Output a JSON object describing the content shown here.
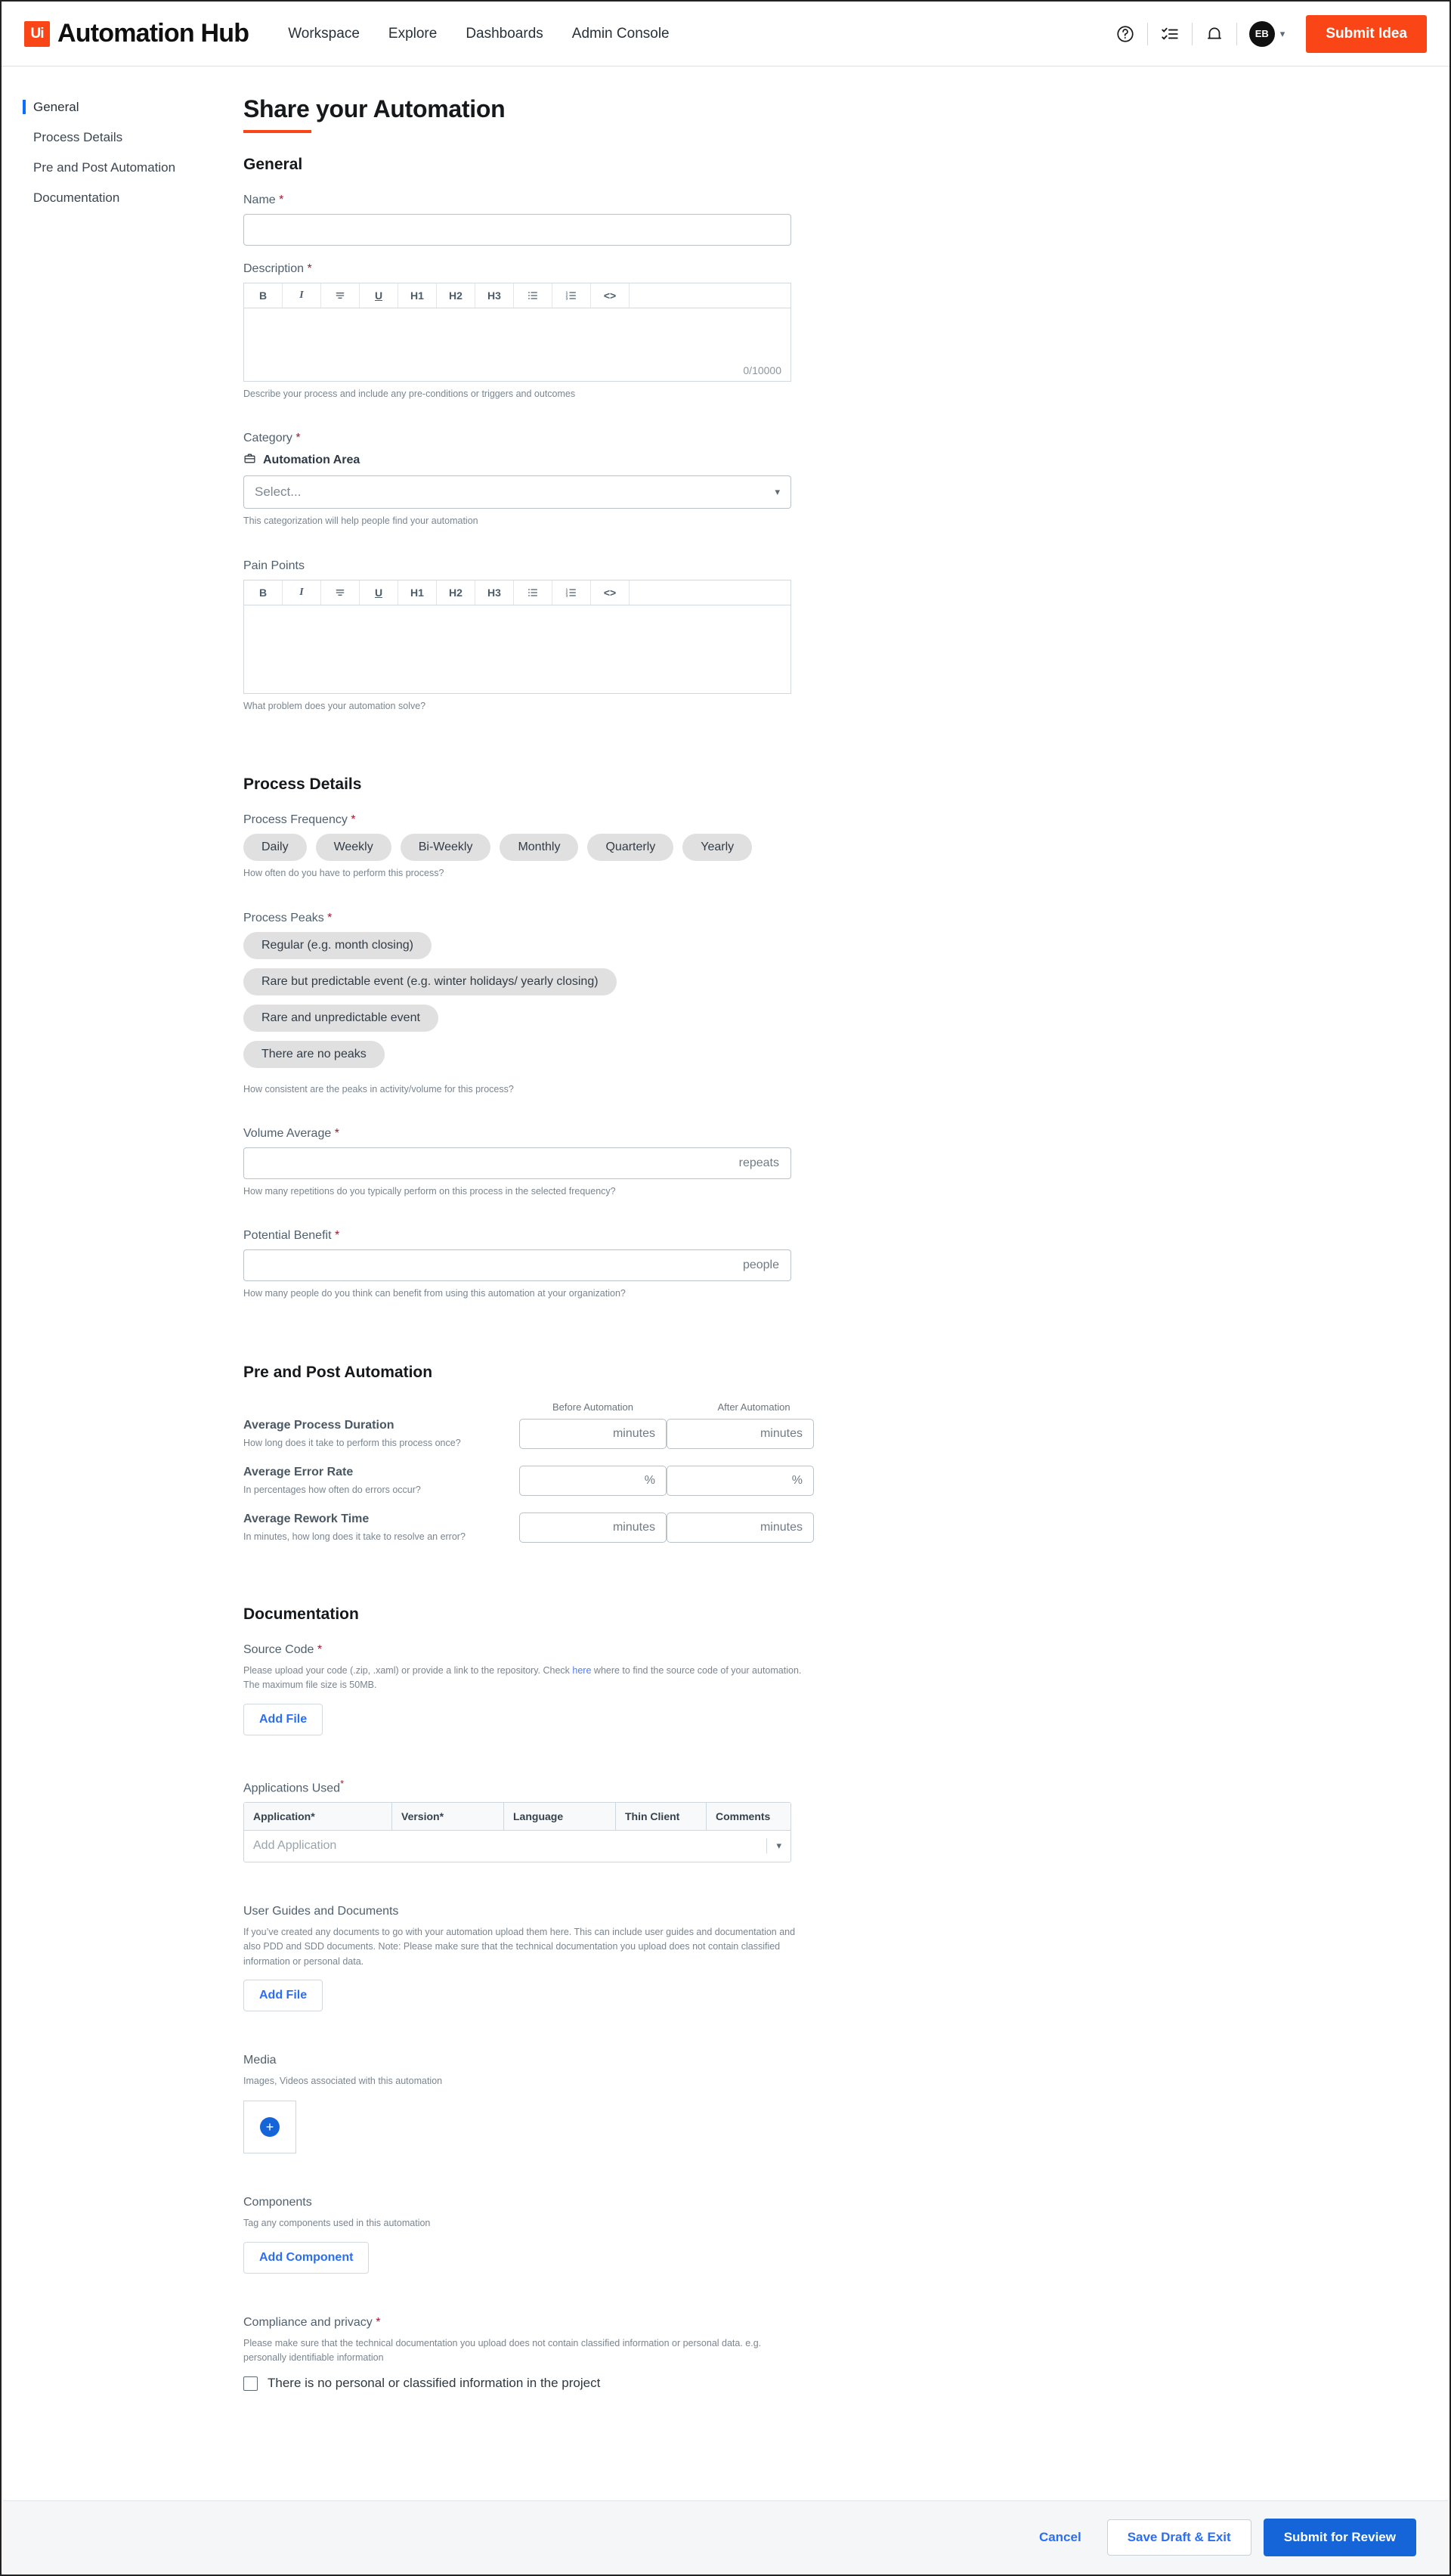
{
  "header": {
    "brand_mark": "Ui",
    "brand_text": "Automation Hub",
    "nav": [
      {
        "label": "Workspace"
      },
      {
        "label": "Explore"
      },
      {
        "label": "Dashboards"
      },
      {
        "label": "Admin Console"
      }
    ],
    "icons": {
      "help": "help-circle-icon",
      "tasks": "checklist-icon",
      "notifications": "bell-icon"
    },
    "avatar_initials": "EB",
    "submit_idea_label": "Submit Idea",
    "accent_color": "#fa4616"
  },
  "sidebar": {
    "items": [
      {
        "label": "General",
        "active": true
      },
      {
        "label": "Process Details",
        "active": false
      },
      {
        "label": "Pre and Post Automation",
        "active": false
      },
      {
        "label": "Documentation",
        "active": false
      }
    ]
  },
  "page": {
    "title": "Share your Automation"
  },
  "general": {
    "section_title": "General",
    "name": {
      "label": "Name",
      "required": "*",
      "value": "",
      "placeholder": ""
    },
    "description": {
      "label": "Description",
      "required": "*",
      "counter": "0/10000",
      "hint": "Describe your process and include any pre-conditions or triggers and outcomes",
      "value": ""
    },
    "category": {
      "label": "Category",
      "required": "*",
      "area_label": "Automation Area",
      "select_value": "Select...",
      "hint": "This categorization will help people find your automation"
    },
    "pain_points": {
      "label": "Pain Points",
      "hint": "What problem does your automation solve?",
      "value": ""
    },
    "editor_toolbar": [
      {
        "label": "B",
        "name": "bold"
      },
      {
        "label": "I",
        "name": "italic"
      },
      {
        "label": "S",
        "name": "strikethrough"
      },
      {
        "label": "U",
        "name": "underline"
      },
      {
        "label": "H1",
        "name": "heading-1"
      },
      {
        "label": "H2",
        "name": "heading-2"
      },
      {
        "label": "H3",
        "name": "heading-3"
      },
      {
        "label": "☰",
        "name": "bulleted-list"
      },
      {
        "label": "☰",
        "name": "numbered-list"
      },
      {
        "label": "<>",
        "name": "code-block"
      }
    ]
  },
  "process_details": {
    "section_title": "Process Details",
    "frequency": {
      "label": "Process Frequency",
      "required": "*",
      "options": [
        "Daily",
        "Weekly",
        "Bi-Weekly",
        "Monthly",
        "Quarterly",
        "Yearly"
      ],
      "hint": "How often do you have to perform this process?"
    },
    "peaks": {
      "label": "Process Peaks",
      "required": "*",
      "options": [
        "Regular (e.g. month closing)",
        "Rare but predictable event (e.g. winter holidays/ yearly closing)",
        "Rare and unpredictable event",
        "There are no peaks"
      ],
      "hint": "How consistent are the peaks in activity/volume for this process?"
    },
    "volume_average": {
      "label": "Volume Average",
      "required": "*",
      "suffix": "repeats",
      "value": "",
      "hint": "How many repetitions do you typically perform on this process in the selected frequency?"
    },
    "potential_benefit": {
      "label": "Potential Benefit",
      "required": "*",
      "suffix": "people",
      "value": "",
      "hint": "How many people do you think can benefit from using this automation at your organization?"
    }
  },
  "pre_post": {
    "section_title": "Pre and Post Automation",
    "columns": [
      "Before Automation",
      "After Automation"
    ],
    "rows": [
      {
        "name": "Average Process Duration",
        "hint": "How long does it take to perform this process once?",
        "before_unit": "minutes",
        "after_unit": "minutes",
        "before_value": "",
        "after_value": ""
      },
      {
        "name": "Average Error Rate",
        "hint": "In percentages how often do errors occur?",
        "before_unit": "%",
        "after_unit": "%",
        "before_value": "",
        "after_value": ""
      },
      {
        "name": "Average Rework Time",
        "hint": "In minutes, how long does it take to resolve an error?",
        "before_unit": "minutes",
        "after_unit": "minutes",
        "before_value": "",
        "after_value": ""
      }
    ]
  },
  "documentation": {
    "section_title": "Documentation",
    "source_code": {
      "label": "Source Code",
      "required": "*",
      "hint_part1": "Please upload your code (.zip, .xaml) or provide a link to the repository. Check ",
      "hint_link": "here",
      "hint_part2": " where to find the source code of your automation. The maximum file size is 50MB.",
      "button_label": "Add File"
    },
    "applications": {
      "label": "Applications Used",
      "required": "*",
      "columns": [
        "Application*",
        "Version*",
        "Language",
        "Thin Client",
        "Comments"
      ],
      "add_row_placeholder": "Add Application"
    },
    "user_guides": {
      "label": "User Guides and Documents",
      "hint": "If you’ve created any documents to go with your automation upload them here. This can include user guides and documentation and also PDD and SDD documents. Note: Please make sure that the technical documentation you upload does not contain classified information or personal data.",
      "button_label": "Add File"
    },
    "media": {
      "label": "Media",
      "hint": "Images, Videos associated with this automation",
      "add_icon": "plus-icon"
    },
    "components": {
      "label": "Components",
      "hint": "Tag any components used in this automation",
      "button_label": "Add Component"
    },
    "compliance": {
      "label": "Compliance and privacy",
      "required": "*",
      "hint": "Please make sure that the technical documentation you upload does not contain classified information or personal data. e.g. personally identifiable information",
      "checkbox_label": "There is no personal or classified information in the project",
      "checked": false
    }
  },
  "footer": {
    "cancel_label": "Cancel",
    "save_draft_label": "Save Draft & Exit",
    "submit_label": "Submit for Review"
  }
}
